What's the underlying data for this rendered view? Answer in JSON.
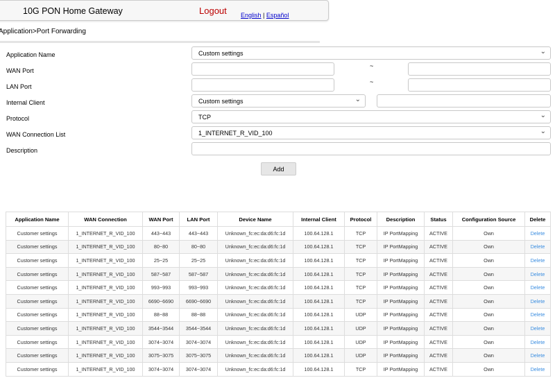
{
  "header": {
    "title": "10G PON Home Gateway",
    "logout": "Logout",
    "lang_en": "English",
    "lang_sep": "|",
    "lang_es": "Español"
  },
  "breadcrumb": "Application>Port Forwarding",
  "form": {
    "app_name_label": "Application Name",
    "app_name_value": "Custom settings",
    "wan_port_label": "WAN Port",
    "lan_port_label": "LAN Port",
    "tilde": "~",
    "internal_client_label": "Internal Client",
    "internal_client_value": "Custom settings",
    "protocol_label": "Protocol",
    "protocol_value": "TCP",
    "wan_conn_label": "WAN Connection List",
    "wan_conn_value": "1_INTERNET_R_VID_100",
    "description_label": "Description",
    "add_label": "Add"
  },
  "table": {
    "headers": [
      "Application Name",
      "WAN Connection",
      "WAN Port",
      "LAN Port",
      "Device Name",
      "Internal Client",
      "Protocol",
      "Description",
      "Status",
      "Configuration Source",
      "Delete"
    ],
    "rows": [
      [
        "Customer settings",
        "1_INTERNET_R_VID_100",
        "443~443",
        "443~443",
        "Unknown_fc:ec:da:d6:fc:1d",
        "100.64.128.1",
        "TCP",
        "IP PortMapping",
        "ACTIVE",
        "Own",
        "Delete"
      ],
      [
        "Customer settings",
        "1_INTERNET_R_VID_100",
        "80~80",
        "80~80",
        "Unknown_fc:ec:da:d6:fc:1d",
        "100.64.128.1",
        "TCP",
        "IP PortMapping",
        "ACTIVE",
        "Own",
        "Delete"
      ],
      [
        "Customer settings",
        "1_INTERNET_R_VID_100",
        "25~25",
        "25~25",
        "Unknown_fc:ec:da:d6:fc:1d",
        "100.64.128.1",
        "TCP",
        "IP PortMapping",
        "ACTIVE",
        "Own",
        "Delete"
      ],
      [
        "Customer settings",
        "1_INTERNET_R_VID_100",
        "587~587",
        "587~587",
        "Unknown_fc:ec:da:d6:fc:1d",
        "100.64.128.1",
        "TCP",
        "IP PortMapping",
        "ACTIVE",
        "Own",
        "Delete"
      ],
      [
        "Customer settings",
        "1_INTERNET_R_VID_100",
        "993~993",
        "993~993",
        "Unknown_fc:ec:da:d6:fc:1d",
        "100.64.128.1",
        "TCP",
        "IP PortMapping",
        "ACTIVE",
        "Own",
        "Delete"
      ],
      [
        "Customer settings",
        "1_INTERNET_R_VID_100",
        "6690~6690",
        "6690~6690",
        "Unknown_fc:ec:da:d6:fc:1d",
        "100.64.128.1",
        "TCP",
        "IP PortMapping",
        "ACTIVE",
        "Own",
        "Delete"
      ],
      [
        "Customer settings",
        "1_INTERNET_R_VID_100",
        "88~88",
        "88~88",
        "Unknown_fc:ec:da:d6:fc:1d",
        "100.64.128.1",
        "UDP",
        "IP PortMapping",
        "ACTIVE",
        "Own",
        "Delete"
      ],
      [
        "Customer settings",
        "1_INTERNET_R_VID_100",
        "3544~3544",
        "3544~3544",
        "Unknown_fc:ec:da:d6:fc:1d",
        "100.64.128.1",
        "UDP",
        "IP PortMapping",
        "ACTIVE",
        "Own",
        "Delete"
      ],
      [
        "Customer settings",
        "1_INTERNET_R_VID_100",
        "3074~3074",
        "3074~3074",
        "Unknown_fc:ec:da:d6:fc:1d",
        "100.64.128.1",
        "UDP",
        "IP PortMapping",
        "ACTIVE",
        "Own",
        "Delete"
      ],
      [
        "Customer settings",
        "1_INTERNET_R_VID_100",
        "3075~3075",
        "3075~3075",
        "Unknown_fc:ec:da:d6:fc:1d",
        "100.64.128.1",
        "UDP",
        "IP PortMapping",
        "ACTIVE",
        "Own",
        "Delete"
      ],
      [
        "Customer settings",
        "1_INTERNET_R_VID_100",
        "3074~3074",
        "3074~3074",
        "Unknown_fc:ec:da:d6:fc:1d",
        "100.64.128.1",
        "TCP",
        "IP PortMapping",
        "ACTIVE",
        "Own",
        "Delete"
      ]
    ]
  }
}
